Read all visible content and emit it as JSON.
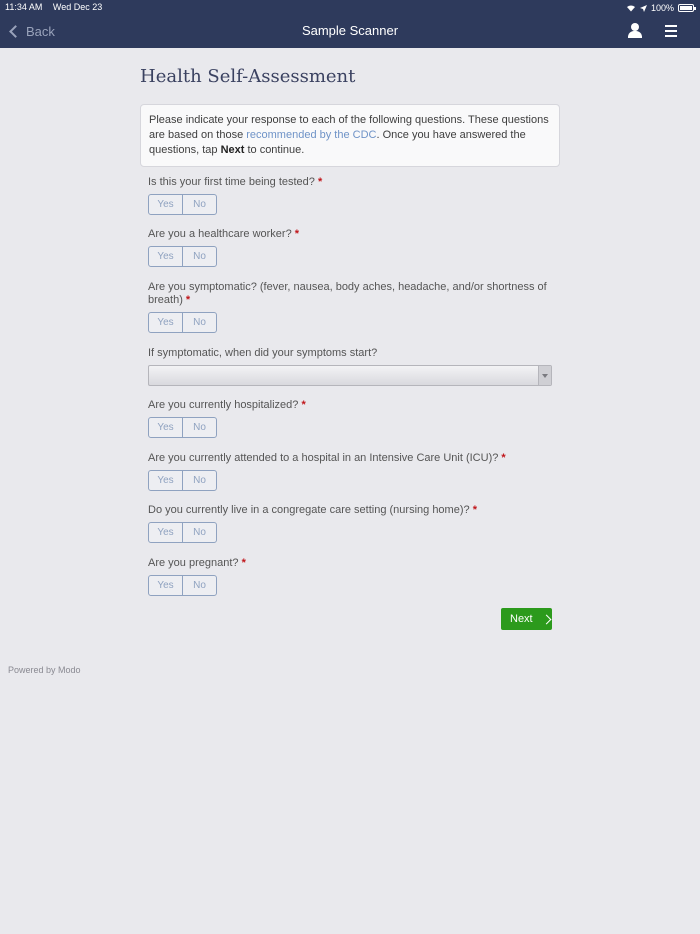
{
  "status_bar": {
    "time": "11:34 AM",
    "date": "Wed Dec 23",
    "battery": "100%"
  },
  "nav": {
    "back_label": "Back",
    "title": "Sample Scanner"
  },
  "page": {
    "title": "Health Self-Assessment",
    "intro_before": "Please indicate your response to each of the following questions. These questions are based on those ",
    "intro_link": "recommended by the CDC",
    "intro_middle": ". Once you have answered the questions, tap ",
    "intro_bold": "Next",
    "intro_after": " to continue."
  },
  "questions": [
    {
      "label": "Is this your first time being tested?",
      "required": "*"
    },
    {
      "label": "Are you a healthcare worker?",
      "required": "*"
    },
    {
      "label": "Are you symptomatic? (fever, nausea, body aches, headache, and/or shortness of breath)",
      "required": "*"
    },
    {
      "label": "If symptomatic, when did your symptoms start?"
    },
    {
      "label": "Are you currently hospitalized?",
      "required": "*"
    },
    {
      "label": "Are you currently attended to a hospital in an Intensive Care Unit (ICU)?",
      "required": "*"
    },
    {
      "label": "Do you currently live in a congregate care setting (nursing home)?",
      "required": "*"
    },
    {
      "label": "Are you pregnant?",
      "required": "*"
    }
  ],
  "options": {
    "yes": "Yes",
    "no": "No"
  },
  "symptom_select": {
    "value": ""
  },
  "actions": {
    "next_label": "Next"
  },
  "footer": {
    "powered_by": "Powered by Modo"
  },
  "icons": {
    "back": "chevron-left-icon",
    "user": "person-icon",
    "menu": "hamburger-icon",
    "next": "chevron-right-icon"
  }
}
